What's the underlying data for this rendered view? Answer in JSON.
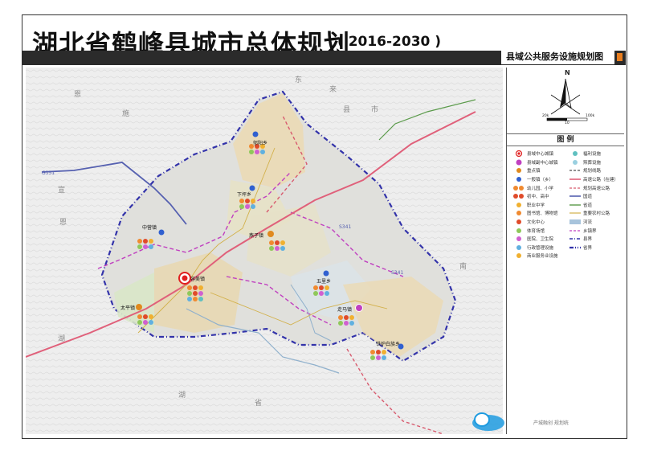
{
  "title": "湖北省鹤峰县城市总体规划",
  "period": "( 2016-2030 )",
  "subtitle": "县域公共服务设施规划图",
  "compass": {
    "north": "N",
    "scale_left": "20k",
    "scale_mid": "10",
    "scale_right": "100k"
  },
  "legend": {
    "header": "图    例",
    "left_items": [
      "县域中心城镇",
      "县域副中心城镇",
      "重点镇",
      "一般镇（乡）",
      "幼儿园、小学",
      "初中、高中",
      "职业中学",
      "图书馆、博物馆",
      "文化中心",
      "体育场馆",
      "医院、卫生院",
      "行政管理设施",
      "商业服务业设施"
    ],
    "right_items": [
      "福利设施",
      "殡葬设施",
      "规划线路",
      "高速公路（在建）",
      "规划高速公路",
      "国道",
      "省道",
      "重要农村公路",
      "河流",
      "乡镇界",
      "县界",
      "省界"
    ]
  },
  "towns": [
    {
      "name": "容美镇",
      "kind": "center"
    },
    {
      "name": "走马镇",
      "kind": "sub-center"
    },
    {
      "name": "燕子镇",
      "kind": "key"
    },
    {
      "name": "太平镇",
      "kind": "key"
    },
    {
      "name": "中营镇",
      "kind": "general"
    },
    {
      "name": "五里乡",
      "kind": "general"
    },
    {
      "name": "下坪乡",
      "kind": "general"
    },
    {
      "name": "邬阳乡",
      "kind": "general"
    },
    {
      "name": "铁炉白族乡",
      "kind": "general"
    }
  ],
  "place_labels": [
    "东",
    "恩",
    "施",
    "市",
    "来",
    "县",
    "南",
    "湖",
    "省",
    "宣",
    "恩",
    "湖"
  ],
  "road_labels": [
    "G351",
    "S341",
    "S341"
  ],
  "watermark": {
    "text": "产城融创 规划统"
  },
  "colors": {
    "accent": "#e87d1e",
    "county_border": "#3333aa",
    "town_border": "#c040c0",
    "highway": "#e0607a",
    "national_road": "#5560b0"
  }
}
